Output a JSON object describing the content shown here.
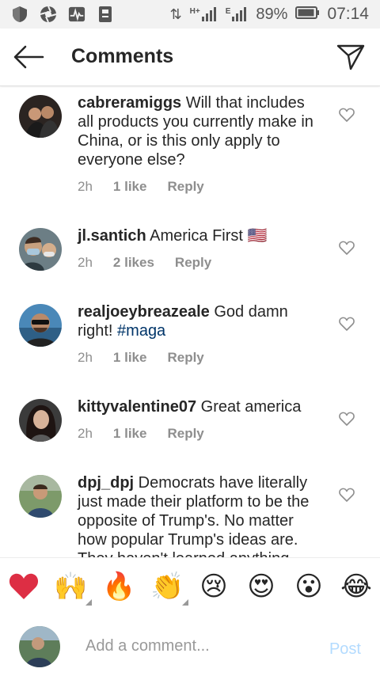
{
  "status_bar": {
    "battery": "89%",
    "time": "07:14",
    "carrier1": "H+",
    "carrier2": "E"
  },
  "header": {
    "title": "Comments"
  },
  "comments": [
    {
      "username": "cabreramiggs",
      "text": "Will that includes all products you currently make in China, or is this only apply to everyone else?",
      "time": "2h",
      "likes": "1 like",
      "reply": "Reply"
    },
    {
      "username": "jl.santich",
      "text": "America First 🇺🇸",
      "time": "2h",
      "likes": "2 likes",
      "reply": "Reply"
    },
    {
      "username": "realjoeybreazeale",
      "text": "God damn right! ",
      "hashtag": "#maga",
      "time": "2h",
      "likes": "1 like",
      "reply": "Reply"
    },
    {
      "username": "kittyvalentine07",
      "text": "Great america",
      "time": "2h",
      "likes": "1 like",
      "reply": "Reply"
    },
    {
      "username": "dpj_dpj",
      "text": "Democrats have literally just made their platform to be the opposite of Trump's. No matter how popular Trump's ideas are. They haven't learned anything"
    }
  ],
  "reactions": [
    "❤",
    "🙌",
    "🔥",
    "👏",
    "😢",
    "😍",
    "😮",
    "😂"
  ],
  "composer": {
    "placeholder": "Add a comment...",
    "post_label": "Post"
  },
  "colors": {
    "heart_red": "#ed4956",
    "hashtag": "#003569",
    "post_disabled": "#b3dbff",
    "meta_gray": "#8e8e8e"
  }
}
